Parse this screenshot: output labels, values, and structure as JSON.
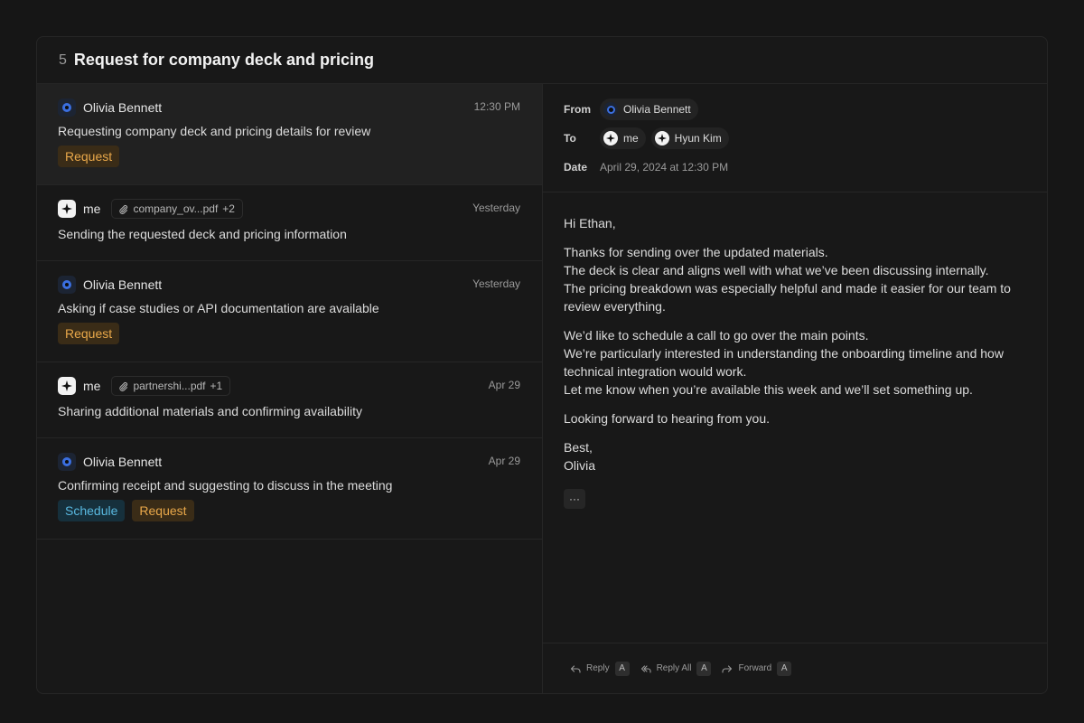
{
  "thread": {
    "count": "5",
    "title": "Request for company deck and pricing"
  },
  "messages": [
    {
      "sender": "Olivia Bennett",
      "avatar": "olivia-avatar",
      "time": "12:30 PM",
      "subject": "Requesting company deck and pricing details for review",
      "tags": [
        "Request"
      ],
      "selected": true
    },
    {
      "sender": "me",
      "avatar": "me-avatar",
      "attachment": {
        "name": "company_ov...pdf",
        "extra": "+2"
      },
      "time": "Yesterday",
      "subject": "Sending the requested deck and pricing information"
    },
    {
      "sender": "Olivia Bennett",
      "avatar": "olivia-avatar",
      "time": "Yesterday",
      "subject": "Asking if case studies or API documentation are available",
      "tags": [
        "Request"
      ]
    },
    {
      "sender": "me",
      "avatar": "me-avatar",
      "attachment": {
        "name": "partnershi...pdf",
        "extra": "+1"
      },
      "time": "Apr 29",
      "subject": "Sharing additional materials and confirming availability"
    },
    {
      "sender": "Olivia Bennett",
      "avatar": "olivia-avatar",
      "time": "Apr 29",
      "subject": "Confirming receipt and suggesting to discuss in the meeting",
      "tags": [
        "Schedule",
        "Request"
      ]
    }
  ],
  "detail": {
    "from_label": "From",
    "from": "Olivia Bennett",
    "to_label": "To",
    "to": [
      "me",
      "Hyun Kim"
    ],
    "date_label": "Date",
    "date": "April 29, 2024 at 12:30 PM",
    "greeting": "Hi Ethan,",
    "para1": [
      "Thanks for sending over the updated materials.",
      "The deck is clear and aligns well with what we’ve been discussing internally.",
      "The pricing breakdown was especially helpful and made it easier for our team to",
      "review everything."
    ],
    "para2": [
      "We’d like to schedule a call to go over the main points.",
      "We’re particularly interested in understanding the onboarding timeline and how",
      "technical integration would work.",
      "Let me know when you’re available this week and we’ll set something up."
    ],
    "para3": "Looking forward to hearing from you.",
    "signoff": "Best,",
    "signature": "Olivia",
    "more": "···"
  },
  "actions": {
    "reply": "Reply",
    "reply_all": "Reply All",
    "forward": "Forward",
    "shortcut": "A"
  },
  "colors": {
    "request_tag": "#e9a84a",
    "schedule_tag": "#59b9e0",
    "olivia_avatar": "#3b6fe0"
  }
}
